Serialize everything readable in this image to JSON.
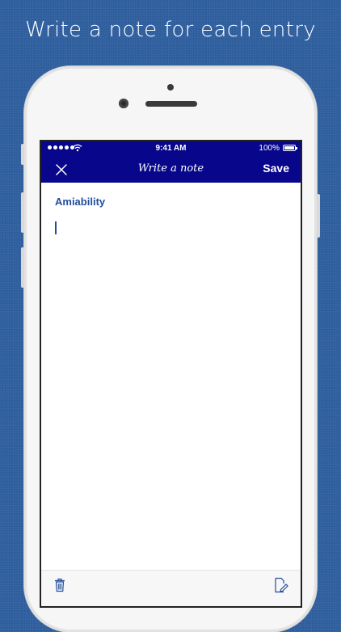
{
  "headline": "Write a note for each entry",
  "status_bar": {
    "time": "9:41 AM",
    "battery": "100%"
  },
  "nav": {
    "title": "Write a note",
    "save_label": "Save"
  },
  "note": {
    "entry_title": "Amiability",
    "text": ""
  },
  "icons": {
    "close": "close-icon",
    "trash": "trash-icon",
    "edit": "edit-note-icon"
  },
  "colors": {
    "nav_background": "#08078c",
    "accent": "#1f4e9e",
    "background": "#2f5f9f"
  }
}
